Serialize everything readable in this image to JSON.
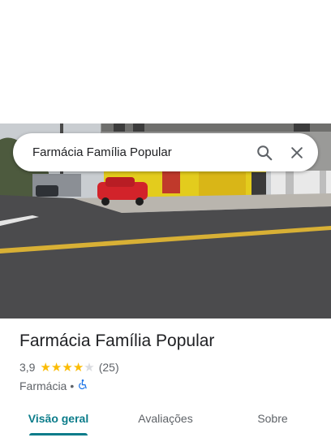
{
  "search": {
    "query": "Farmácia Família Popular",
    "search_icon": "search-icon",
    "close_icon": "close-icon"
  },
  "place": {
    "name": "Farmácia Família Popular",
    "rating": "3,9",
    "rating_value": 3.9,
    "review_count": "(25)",
    "category": "Farmácia",
    "separator": "•",
    "accessibility_icon": "wheelchair-icon"
  },
  "tabs": [
    {
      "label": "Visão geral",
      "active": true
    },
    {
      "label": "Avaliações",
      "active": false
    },
    {
      "label": "Sobre",
      "active": false
    }
  ],
  "colors": {
    "accent": "#0b7c8a",
    "star": "#fbbc04",
    "star_empty": "#dadce0",
    "text": "#202124",
    "muted": "#5f6368"
  }
}
